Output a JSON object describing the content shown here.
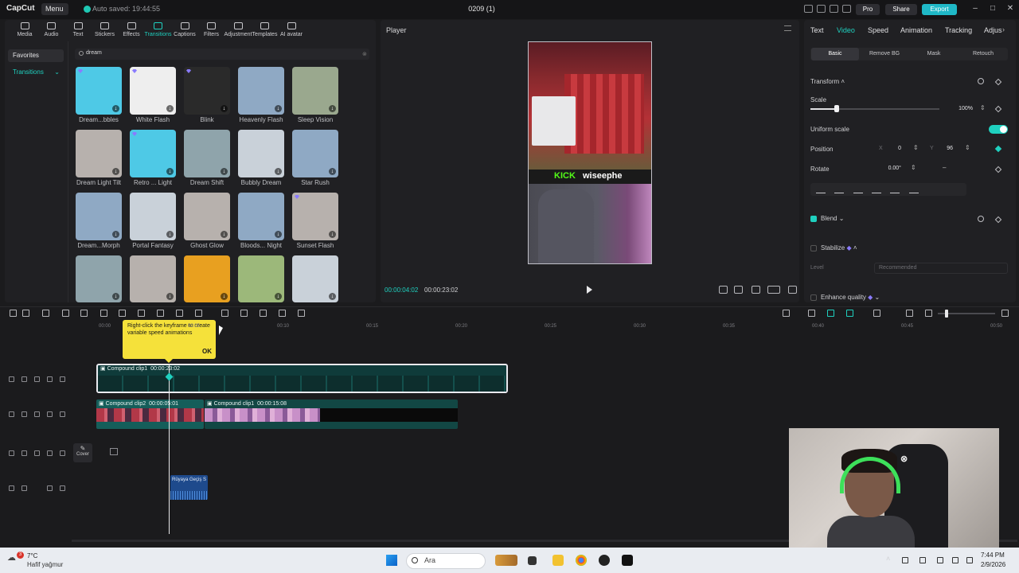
{
  "app": {
    "logo": "CapCut",
    "menu_label": "Menu",
    "autosave": "Auto saved: 19:44:55",
    "project_title": "0209 (1)",
    "pro_label": "Pro",
    "share_label": "Share",
    "export_label": "Export"
  },
  "window_controls": [
    "–",
    "□",
    "✕"
  ],
  "media_tabs": [
    {
      "label": "Media",
      "icon": "media-icon"
    },
    {
      "label": "Audio",
      "icon": "audio-icon"
    },
    {
      "label": "Text",
      "icon": "text-icon"
    },
    {
      "label": "Stickers",
      "icon": "stickers-icon"
    },
    {
      "label": "Effects",
      "icon": "effects-icon"
    },
    {
      "label": "Transitions",
      "icon": "transitions-icon",
      "active": true
    },
    {
      "label": "Captions",
      "icon": "captions-icon"
    },
    {
      "label": "Filters",
      "icon": "filters-icon"
    },
    {
      "label": "Adjustment",
      "icon": "adjustment-icon"
    },
    {
      "label": "Templates",
      "icon": "templates-icon"
    },
    {
      "label": "AI avatar",
      "icon": "ai-avatar-icon"
    }
  ],
  "sidebar": {
    "favorites": "Favorites",
    "transitions": "Transitions"
  },
  "search": {
    "value": "dream"
  },
  "transitions": [
    {
      "label": "Dream...bbles",
      "color": "#4ec9e6"
    },
    {
      "label": "White Flash",
      "color": "#eeeeee"
    },
    {
      "label": "Blink",
      "color": "#2a2a2a"
    },
    {
      "label": "Heavenly Flash",
      "color": "#8fa9c4"
    },
    {
      "label": "Sleep Vision",
      "color": "#9aa88e"
    },
    {
      "label": "Dream Light Tilt",
      "color": "#b7b1ad"
    },
    {
      "label": "Retro ... Light",
      "color": "#4ec9e6"
    },
    {
      "label": "Dream Shift",
      "color": "#8fa4ab"
    },
    {
      "label": "Bubbly Dream",
      "color": "#c9d1d9"
    },
    {
      "label": "Star Rush",
      "color": "#8fa9c4"
    },
    {
      "label": "Dream...Morph",
      "color": "#8fa9c4"
    },
    {
      "label": "Portal Fantasy",
      "color": "#c9d1d9"
    },
    {
      "label": "Ghost Glow",
      "color": "#b7b1ad"
    },
    {
      "label": "Bloods... Night",
      "color": "#8fa9c4"
    },
    {
      "label": "Sunset Flash",
      "color": "#b7b1ad"
    },
    {
      "label": "",
      "color": "#8fa4ab"
    },
    {
      "label": "",
      "color": "#b7b1ad"
    },
    {
      "label": "",
      "color": "#e8a020"
    },
    {
      "label": "",
      "color": "#9cb87a"
    },
    {
      "label": "",
      "color": "#c9d1d9"
    }
  ],
  "player": {
    "title": "Player",
    "time_current": "00:00:04:02",
    "time_total": "00:00:23:02",
    "video_kick": "KICK",
    "video_name": "wiseephe"
  },
  "inspector": {
    "tabs": [
      "Text",
      "Video",
      "Speed",
      "Animation",
      "Tracking",
      "Adjus"
    ],
    "active_tab": "Video",
    "subtabs": [
      "Basic",
      "Remove BG",
      "Mask",
      "Retouch"
    ],
    "transform": "Transform",
    "scale_label": "Scale",
    "scale_value": "100%",
    "scale_fraction": 0.2,
    "uniform_scale": "Uniform scale",
    "position_label": "Position",
    "pos_x_label": "X",
    "pos_x": "0",
    "pos_y_label": "Y",
    "pos_y": "96",
    "rotate_label": "Rotate",
    "rotate_value": "0.00°",
    "rotate_dash": "–",
    "blend": "Blend",
    "stabilize": "Stabilize",
    "level_label": "Level",
    "level_value": "Recommended",
    "enhance": "Enhance quality"
  },
  "timeline": {
    "ticks": [
      "00:00",
      "00:05",
      "00:10",
      "00:15",
      "00:20",
      "00:25",
      "00:30",
      "00:35",
      "00:40",
      "00:45",
      "00:50"
    ],
    "tooltip_text": "Right-click the keyframe to create variable speed animations",
    "tooltip_ok": "OK",
    "clip_main_name": "Compound clip1",
    "clip_main_dur": "00:00:23:02",
    "clip_a_name": "Compound clip2",
    "clip_a_dur": "00:00:05:01",
    "clip_b_name": "Compound clip1",
    "clip_b_dur": "00:00:15:08",
    "cover_label": "Cover",
    "audio_name": "Rüyaya Geçiş S"
  },
  "taskbar": {
    "weather_badge": "3",
    "temp": "7°C",
    "weather": "Hafif yağmur",
    "search_placeholder": "Ara",
    "time": "7:44 PM",
    "date": "2/9/2026"
  }
}
